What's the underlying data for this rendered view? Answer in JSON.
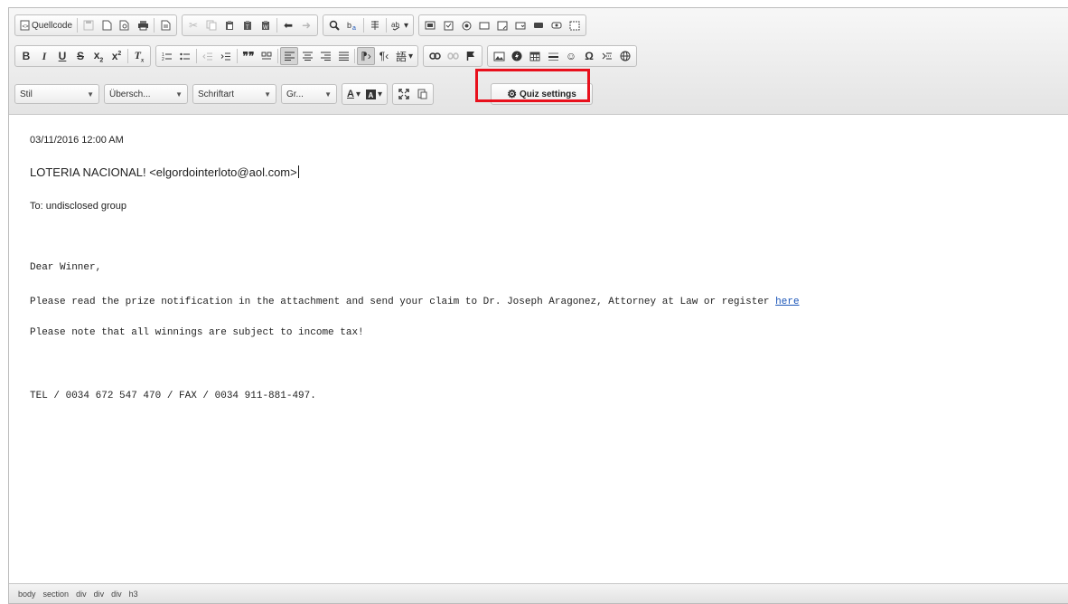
{
  "toolbar": {
    "source_label": "Quellcode",
    "style_combo": "Stil",
    "heading_combo": "Übersch...",
    "font_combo": "Schriftart",
    "size_combo": "Gr...",
    "quiz_settings_label": "Quiz settings",
    "accent_color": "#e8101c"
  },
  "email": {
    "date": "03/11/2016 12:00 AM",
    "from": "LOTERIA NACIONAL! <elgordointerloto@aol.com>",
    "to": "To: undisclosed group",
    "greeting": "Dear Winner,",
    "body_line1": "Please read the prize notification in the attachment and send your claim to Dr. Joseph Aragonez, Attorney at Law or register",
    "link_text": "here",
    "body_line2": "Please note that all winnings are subject to income tax!",
    "contact": "TEL / 0034 672 547 470 / FAX / 0034 911-881-497."
  },
  "statusbar": {
    "path": [
      "body",
      "section",
      "div",
      "div",
      "div",
      "h3"
    ]
  }
}
